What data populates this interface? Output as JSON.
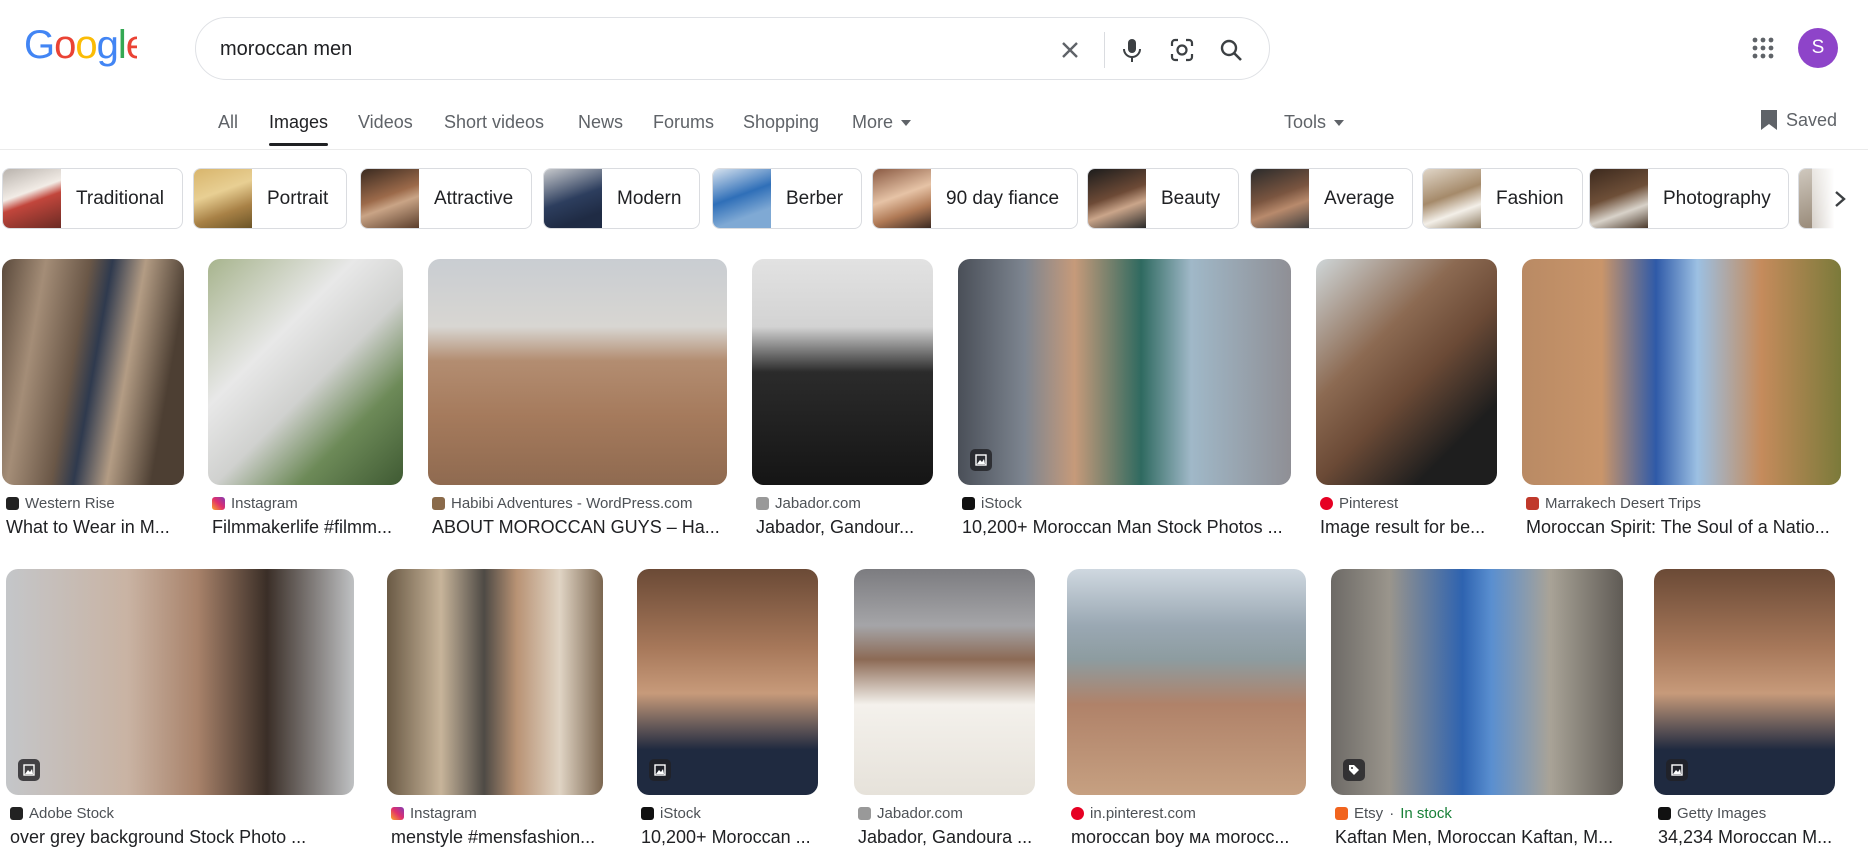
{
  "search": {
    "query": "moroccan men"
  },
  "logo": {
    "text": "Google"
  },
  "user": {
    "initial": "S"
  },
  "tabs": [
    {
      "label": "All"
    },
    {
      "label": "Images"
    },
    {
      "label": "Videos"
    },
    {
      "label": "Short videos"
    },
    {
      "label": "News"
    },
    {
      "label": "Forums"
    },
    {
      "label": "Shopping"
    },
    {
      "label": "More"
    }
  ],
  "tools_label": "Tools",
  "saved_label": "Saved",
  "chips": [
    {
      "label": "Traditional"
    },
    {
      "label": "Portrait"
    },
    {
      "label": "Attractive"
    },
    {
      "label": "Modern"
    },
    {
      "label": "Berber"
    },
    {
      "label": "90 day fiance"
    },
    {
      "label": "Beauty"
    },
    {
      "label": "Average"
    },
    {
      "label": "Fashion"
    },
    {
      "label": "Photography"
    }
  ],
  "results": [
    {
      "source": "Western Rise",
      "title": "What to Wear in M..."
    },
    {
      "source": "Instagram",
      "title": "Filmmakerlife #filmm..."
    },
    {
      "source": "Habibi Adventures - WordPress.com",
      "title": "ABOUT MOROCCAN GUYS – Ha..."
    },
    {
      "source": "Jabador.com",
      "title": "Jabador, Gandour..."
    },
    {
      "source": "iStock",
      "title": "10,200+ Moroccan Man Stock Photos ..."
    },
    {
      "source": "Pinterest",
      "title": "Image result for be..."
    },
    {
      "source": "Marrakech Desert Trips",
      "title": "Moroccan Spirit: The Soul of a Natio..."
    },
    {
      "source": "Adobe Stock",
      "title": "over grey background Stock Photo ..."
    },
    {
      "source": "Instagram",
      "title": "menstyle #mensfashion..."
    },
    {
      "source": "iStock",
      "title": "10,200+ Moroccan ..."
    },
    {
      "source": "Jabador.com",
      "title": "Jabador, Gandoura ..."
    },
    {
      "source": "in.pinterest.com",
      "title": "moroccan boy ᴍᴀ morocc..."
    },
    {
      "source": "Etsy",
      "stock": "In stock",
      "title": "Kaftan Men, Moroccan Kaftan, M..."
    },
    {
      "source": "Getty Images",
      "title": "34,234 Moroccan M..."
    }
  ]
}
